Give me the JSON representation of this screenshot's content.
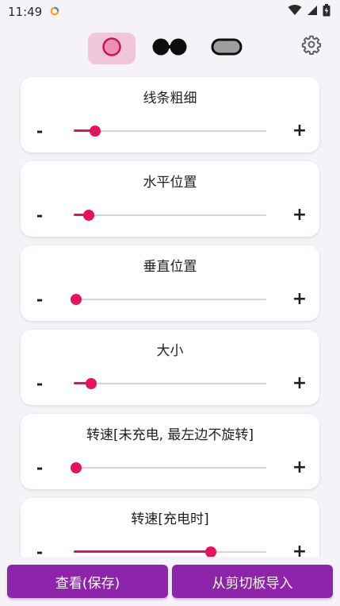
{
  "status_bar": {
    "time": "11:49",
    "icons": [
      "notification-ring-icon",
      "wifi-icon",
      "signal-icon",
      "battery-charging-icon"
    ]
  },
  "toolbar": {
    "modes": [
      {
        "name": "single-circle-mode",
        "active": true
      },
      {
        "name": "double-circle-mode",
        "active": false
      },
      {
        "name": "pill-mode",
        "active": false
      }
    ],
    "settings_icon": "gear-icon"
  },
  "sliders": [
    {
      "title": "线条粗细",
      "minus": "-",
      "plus": "+",
      "value": 0.11
    },
    {
      "title": "水平位置",
      "minus": "-",
      "plus": "+",
      "value": 0.08
    },
    {
      "title": "垂直位置",
      "minus": "-",
      "plus": "+",
      "value": 0.01
    },
    {
      "title": "大小",
      "minus": "-",
      "plus": "+",
      "value": 0.09
    },
    {
      "title": "转速[未充电, 最左边不旋转]",
      "minus": "-",
      "plus": "+",
      "value": 0.0
    },
    {
      "title": "转速[充电时]",
      "minus": "-",
      "plus": "+",
      "value": 0.71
    }
  ],
  "buttons": {
    "view_save": "查看(保存)",
    "import_clipboard": "从剪切板导入"
  },
  "colors": {
    "accent": "#e8115b",
    "active_mode_bg": "#f1c6d8",
    "primary_button": "#8e24aa",
    "background": "#f5f2f8"
  }
}
